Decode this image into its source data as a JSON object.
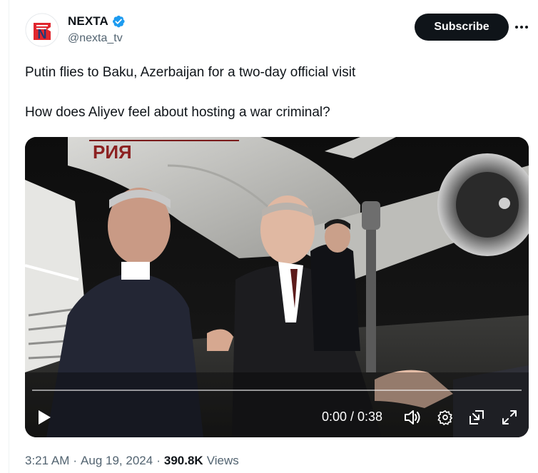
{
  "account": {
    "display_name": "NEXTA",
    "handle": "@nexta_tv",
    "avatar_letter": "N",
    "verified": true
  },
  "actions": {
    "subscribe_label": "Subscribe",
    "more_icon": "more-horizontal-icon"
  },
  "tweet": {
    "line1": "Putin flies to Baku, Azerbaijan for a two-day official visit",
    "line2": "How does Aliyev feel about hosting a war criminal?"
  },
  "video": {
    "aircraft_lettering": "РИЯ",
    "current_time": "0:00",
    "duration": "0:38",
    "time_display": "0:00 / 0:38",
    "progress_fraction": 0.0,
    "controls": [
      "play-icon",
      "volume-icon",
      "gear-icon",
      "picture-in-picture-icon",
      "fullscreen-icon"
    ]
  },
  "meta": {
    "time": "3:21 AM",
    "date": "Aug 19, 2024",
    "views_count": "390.8K",
    "views_label": "Views"
  },
  "colors": {
    "accent": "#1d9bf0",
    "text_primary": "#0f1419",
    "text_secondary": "#536471",
    "button_dark": "#0f1419",
    "brand_red": "#e0262e",
    "brand_navy": "#1e3a78"
  }
}
